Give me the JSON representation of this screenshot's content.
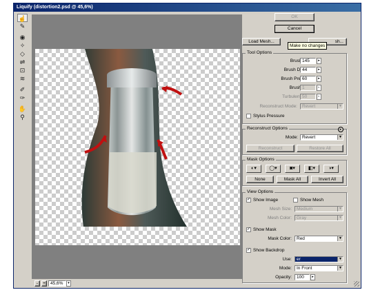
{
  "window": {
    "title": "Liquify (distortion2.psd @ 45,6%)"
  },
  "toolbox": {
    "tools": [
      "forward-warp-tool",
      "reconstruct-tool",
      "twirl-clockwise-tool",
      "pucker-tool",
      "bloat-tool",
      "push-left-tool",
      "mirror-tool",
      "turbulence-tool",
      "freeze-mask-tool",
      "thaw-mask-tool",
      "hand-tool",
      "zoom-tool"
    ]
  },
  "buttons": {
    "ok": "OK",
    "cancel": "Cancel",
    "load_mesh": "Load Mesh...",
    "save_mesh_fragment": "sh..."
  },
  "tooltip": "Make no changes",
  "tool_options": {
    "title": "Tool Options",
    "brush_size_label": "Brush Size:",
    "brush_size": "145",
    "brush_density_label": "Brush Density:",
    "brush_density": "44",
    "brush_pressure_label": "Brush Pressure:",
    "brush_pressure": "60",
    "brush_rate_label": "Brush Rate:",
    "brush_rate": "1",
    "turbulent_jitter_label": "Turbulent Jitter:",
    "turbulent_jitter": "50",
    "reconstruct_mode_label": "Reconstruct Mode:",
    "reconstruct_mode": "Revert",
    "stylus_pressure": "Stylus Pressure"
  },
  "reconstruct_options": {
    "title": "Reconstruct Options",
    "mode_label": "Mode:",
    "mode": "Revert",
    "reconstruct": "Reconstruct",
    "restore_all": "Restore All"
  },
  "mask_options": {
    "title": "Mask Options",
    "none": "None",
    "mask_all": "Mask All",
    "invert_all": "Invert All"
  },
  "view_options": {
    "title": "View Options",
    "show_image": "Show Image",
    "show_mesh": "Show Mesh",
    "mesh_size_label": "Mesh Size:",
    "mesh_size": "Medium",
    "mesh_color_label": "Mesh Color:",
    "mesh_color": "Gray",
    "show_mask": "Show Mask",
    "mask_color_label": "Mask Color:",
    "mask_color": "Red",
    "show_backdrop": "Show Backdrop",
    "use_label": "Use:",
    "use": "er",
    "mode_label": "Mode:",
    "mode": "In Front",
    "opacity_label": "Opacity:",
    "opacity": "100"
  },
  "status": {
    "zoom": "45,6%"
  }
}
